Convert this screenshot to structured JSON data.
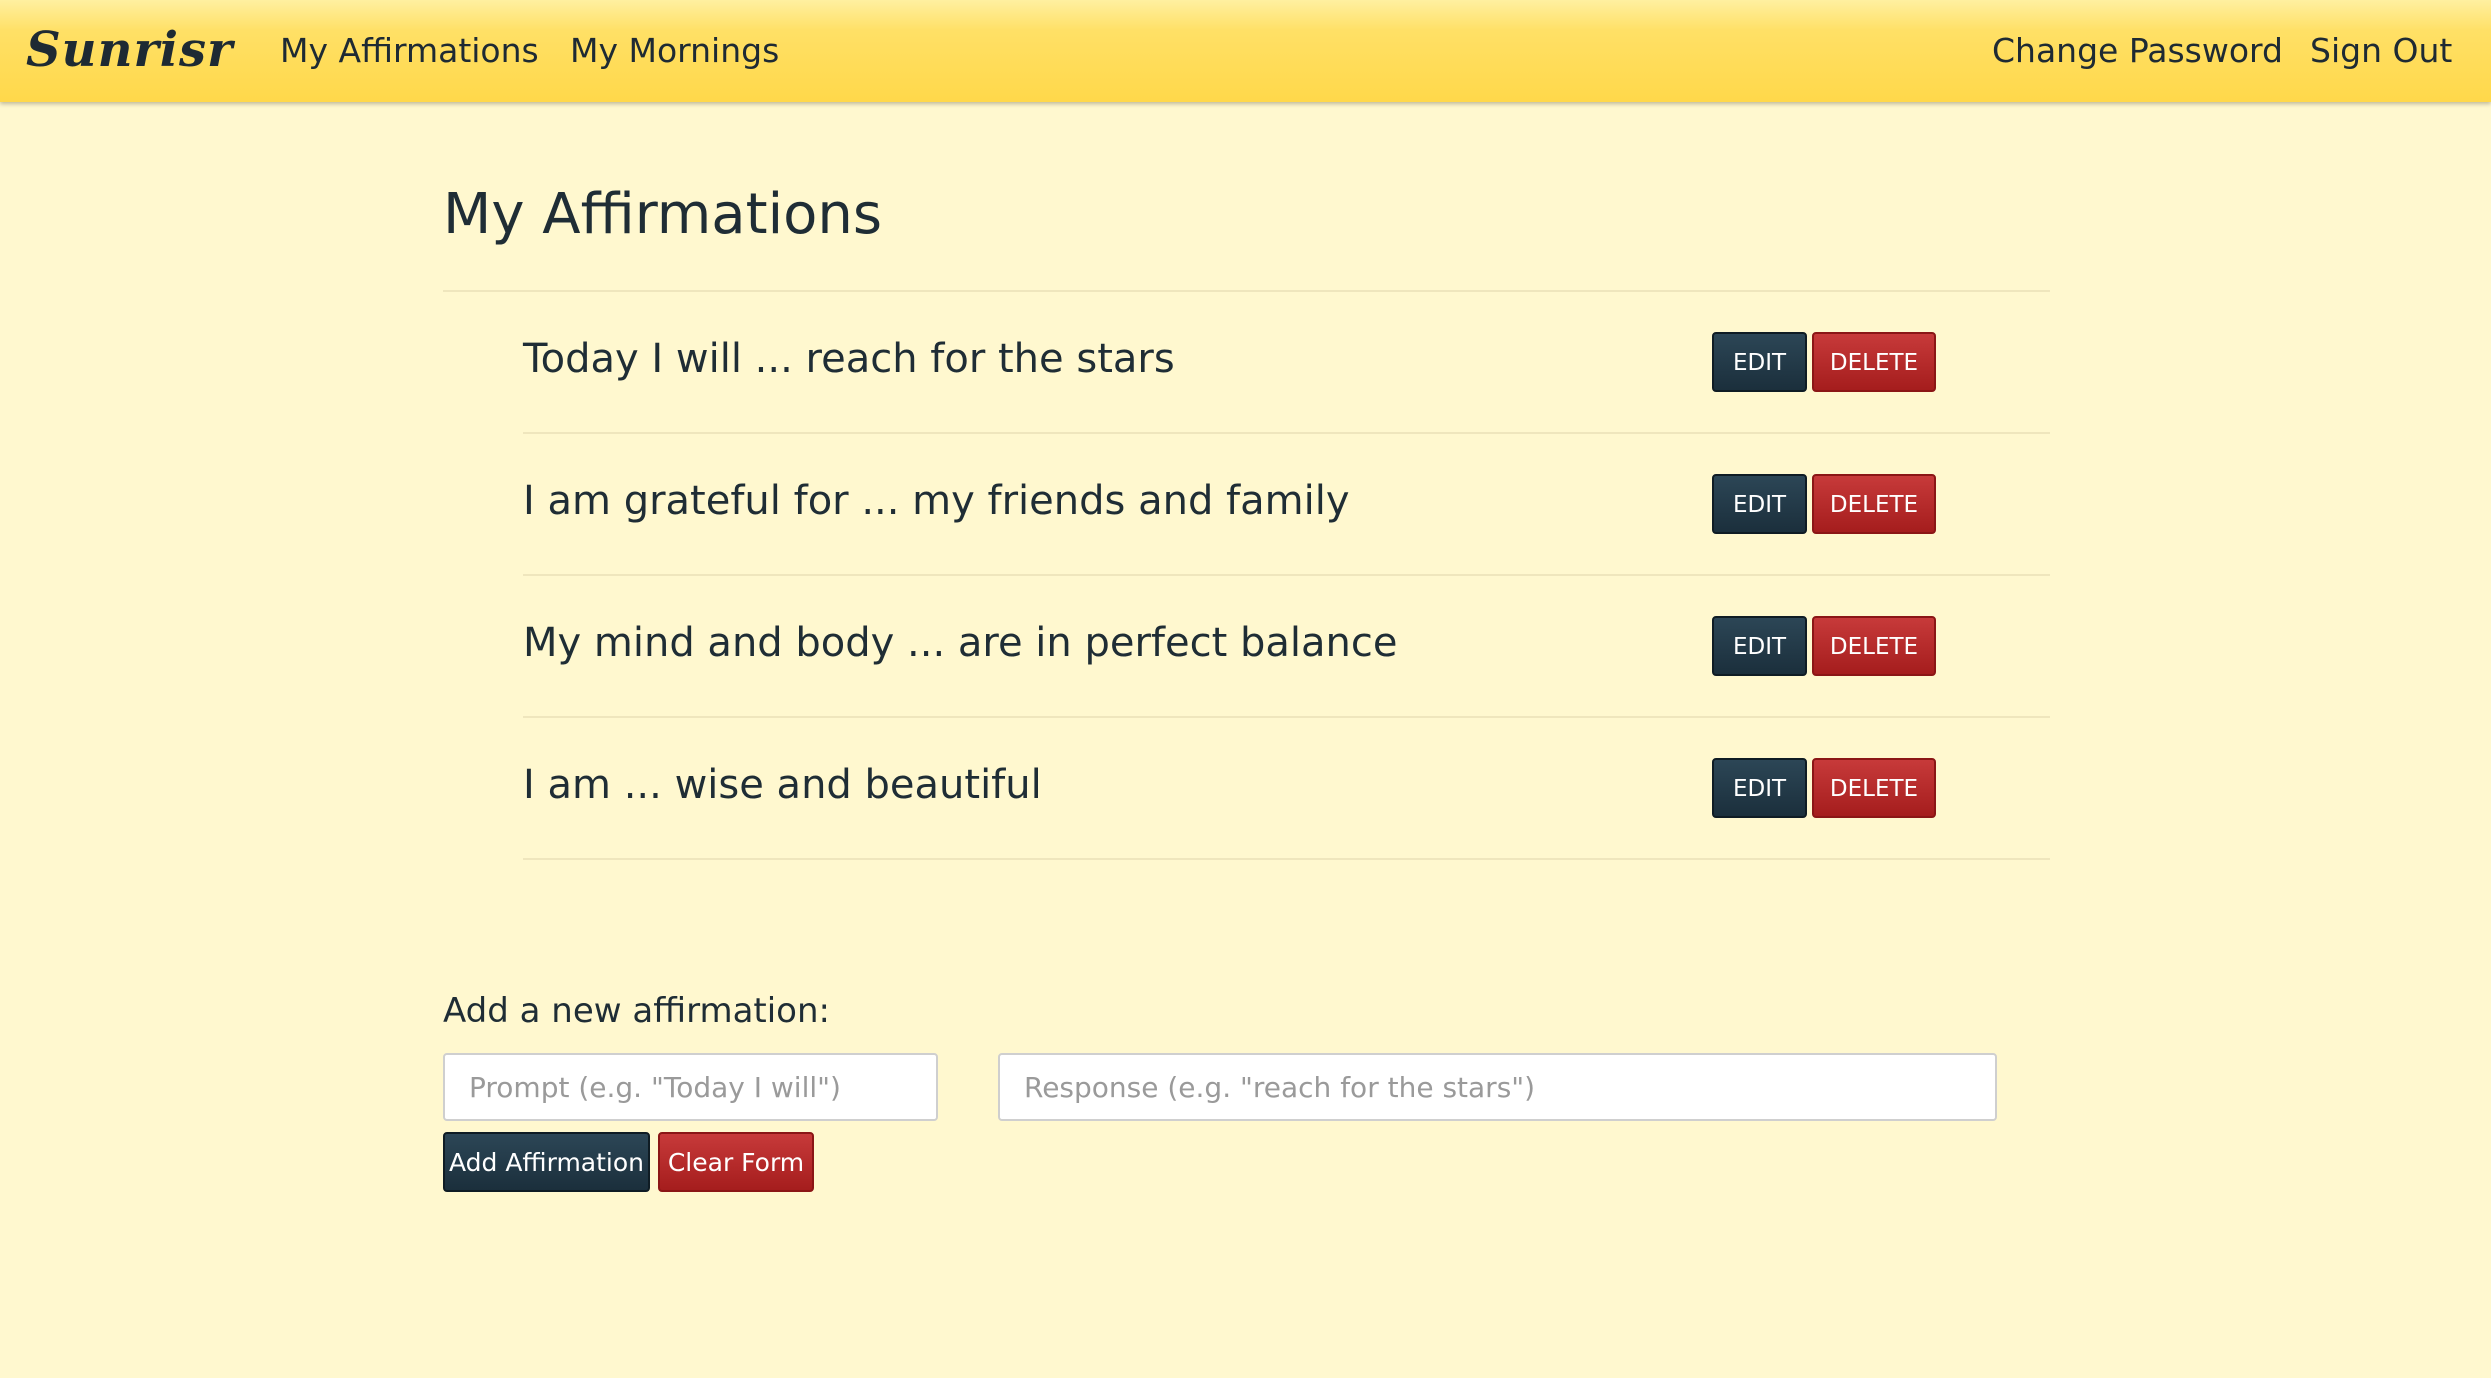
{
  "navbar": {
    "brand": "Sunrisr",
    "left_links": [
      "My Affirmations",
      "My Mornings"
    ],
    "right_links": [
      "Change Password",
      "Sign Out"
    ]
  },
  "main": {
    "title": "My Affirmations",
    "affirmations": [
      {
        "text": "Today I will ... reach for the stars",
        "edit_label": "EDIT",
        "delete_label": "DELETE"
      },
      {
        "text": "I am grateful for ... my friends and family",
        "edit_label": "EDIT",
        "delete_label": "DELETE"
      },
      {
        "text": "My mind and body ... are in perfect balance",
        "edit_label": "EDIT",
        "delete_label": "DELETE"
      },
      {
        "text": "I am ... wise and beautiful",
        "edit_label": "EDIT",
        "delete_label": "DELETE"
      }
    ]
  },
  "form": {
    "heading": "Add a new affirmation:",
    "prompt_placeholder": "Prompt (e.g. \"Today I will\")",
    "response_placeholder": "Response (e.g. \"reach for the stars\")",
    "prompt_value": "",
    "response_value": "",
    "add_label": "Add Affirmation",
    "clear_label": "Clear Form"
  },
  "colors": {
    "background": "#fff8cf",
    "navbar": "#ffd84a",
    "primary": "#1b2f3c",
    "danger": "#b02525",
    "text": "#1f2d35"
  }
}
